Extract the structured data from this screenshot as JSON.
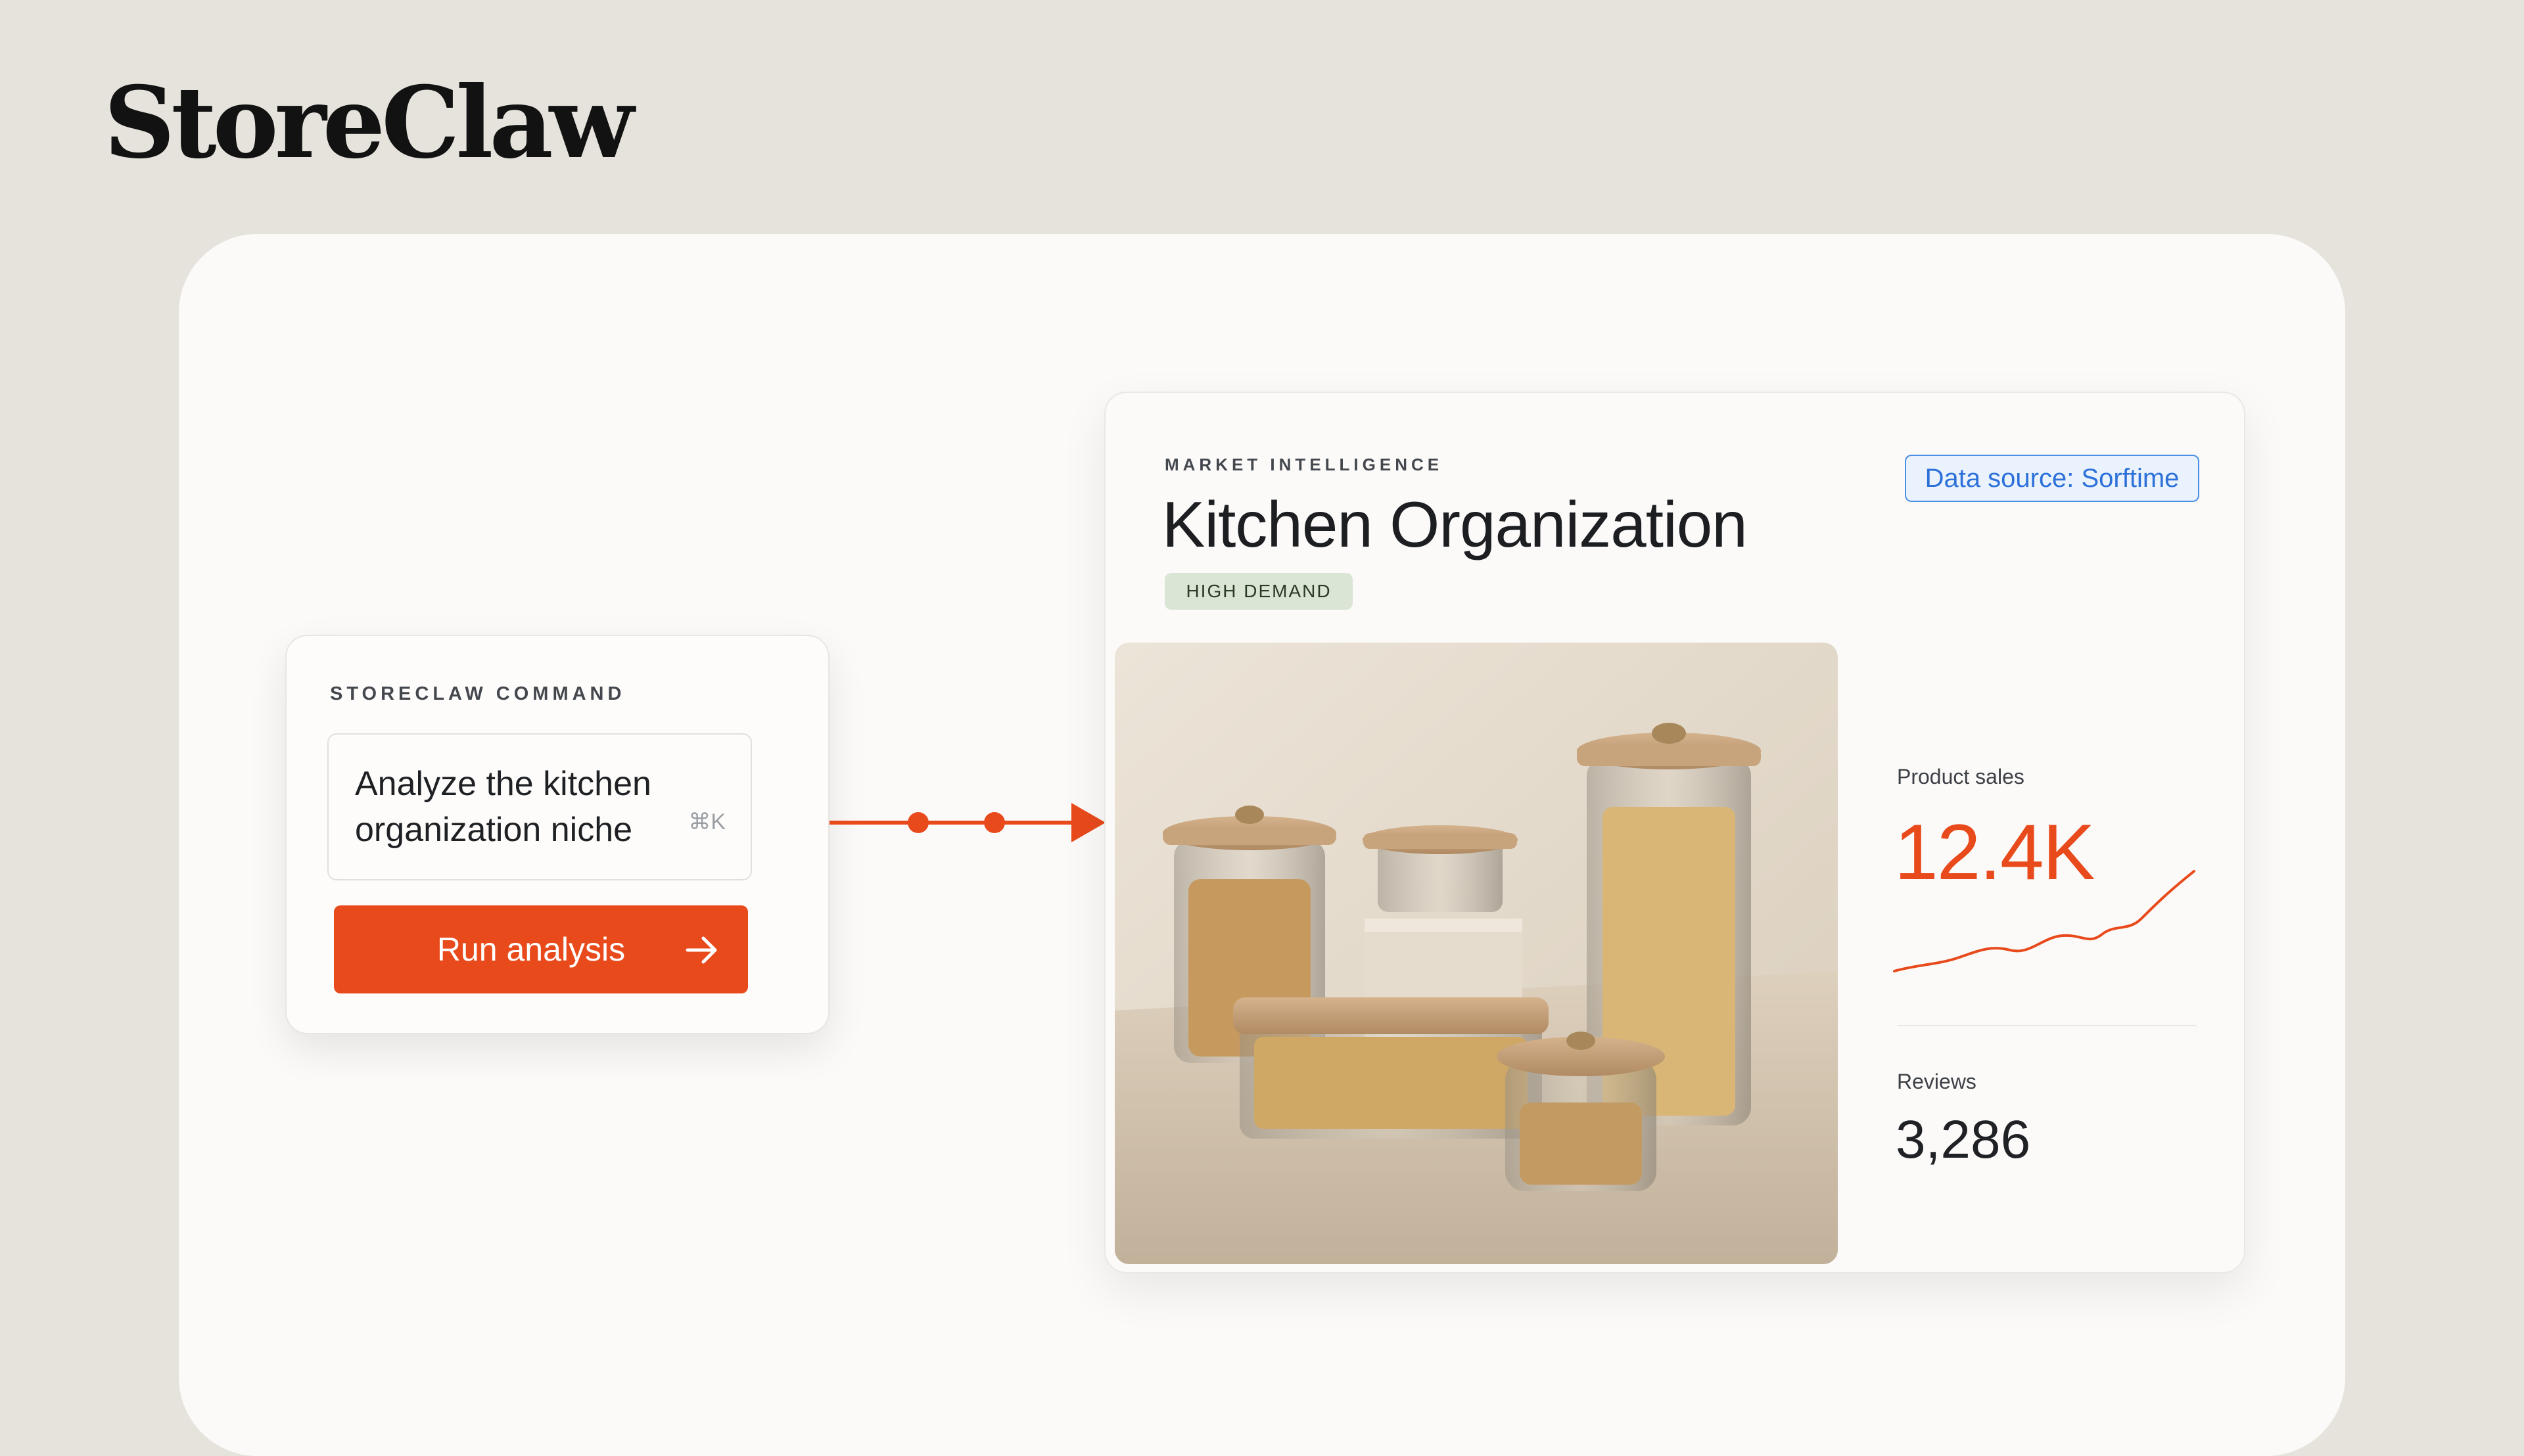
{
  "brand": {
    "name": "StoreClaw",
    "accent": "#e84a1c",
    "link_blue": "#2c70d9"
  },
  "command_card": {
    "label": "STORECLAW COMMAND",
    "input_line1": "Analyze the kitchen",
    "input_line2": "organization niche",
    "shortcut": "⌘K",
    "run_label": "Run analysis",
    "run_icon": "arrow-right-icon"
  },
  "result_card": {
    "eyebrow": "MARKET INTELLIGENCE",
    "title": "Kitchen Organization",
    "badge": "HIGH DEMAND",
    "source": "Data source: Sorftime",
    "image_alt": "Glass storage jars with wooden lids filled with pasta",
    "stats": {
      "sales_label": "Product sales",
      "sales_value": "12.4K",
      "reviews_label": "Reviews",
      "reviews_value": "3,286"
    }
  }
}
